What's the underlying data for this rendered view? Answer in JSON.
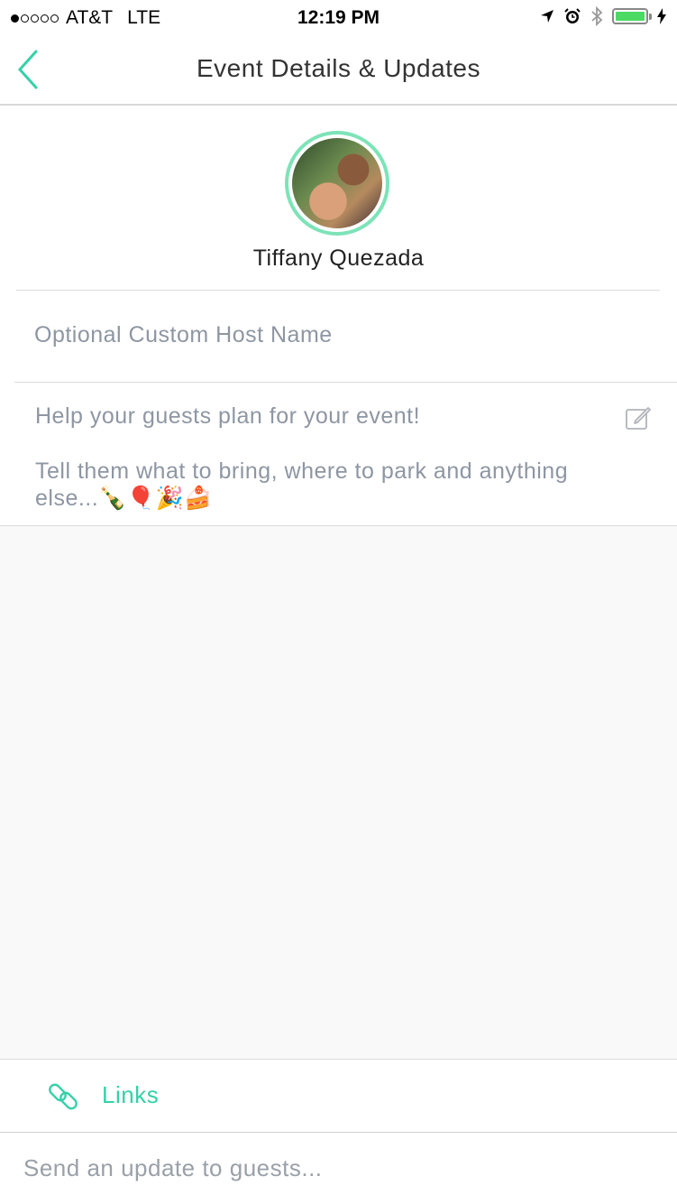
{
  "status_bar": {
    "carrier": "AT&T",
    "network": "LTE",
    "time": "12:19 PM",
    "signal_bars": 1,
    "battery_color": "#4cd964"
  },
  "header": {
    "title": "Event Details & Updates",
    "back_icon": "chevron-left-icon",
    "accent_color": "#34d1a8"
  },
  "host": {
    "name": "Tiffany Quezada",
    "avatar_ring_color": "#7de3b8",
    "custom_name_placeholder": "Optional Custom Host Name"
  },
  "description": {
    "line1": "Help your guests plan for your event!",
    "line2": "Tell them what to bring, where to park and anything else...🍾🎈🎉🍰",
    "edit_icon": "edit-icon"
  },
  "links": {
    "label": "Links",
    "icon": "link-icon"
  },
  "update": {
    "placeholder": "Send an update to guests..."
  }
}
